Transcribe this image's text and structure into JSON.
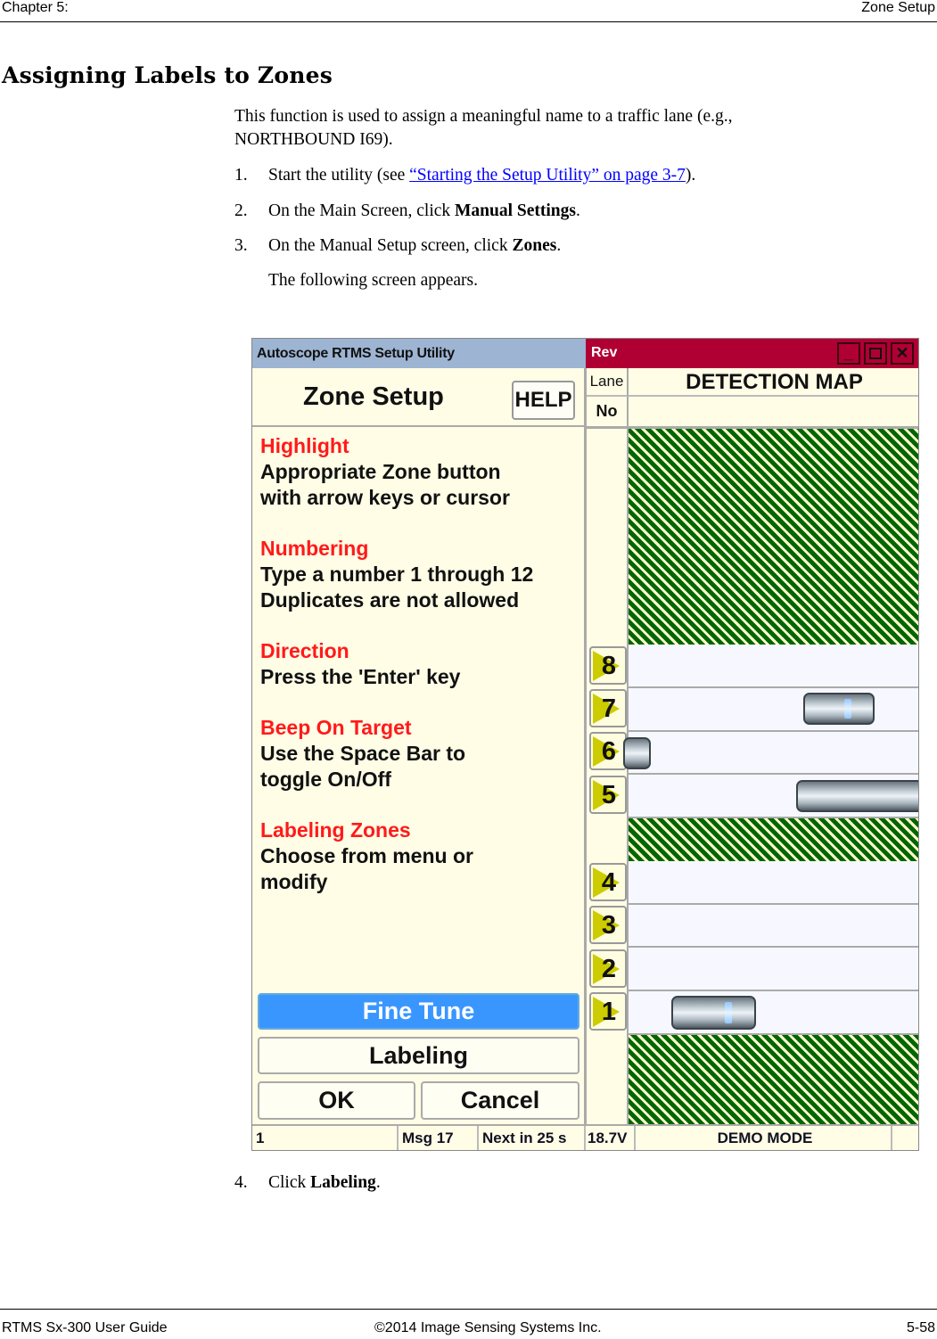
{
  "running_header": {
    "left": "Chapter 5:",
    "right": "Zone Setup"
  },
  "heading": "Assigning Labels to Zones",
  "intro": [
    "This function is used to assign a meaningful name to a traffic lane (e.g.,",
    "NORTHBOUND I69)."
  ],
  "steps": [
    {
      "num": "1.",
      "pre": "Start the utility (see ",
      "link": "“Starting the Setup Utility” on page 3-7",
      "post": ")."
    },
    {
      "num": "2.",
      "pre": "On the Main Screen, click ",
      "bold": "Manual Settings",
      "post": "."
    },
    {
      "num": "3.",
      "pre": "On the Manual Setup screen, click ",
      "bold": "Zones",
      "post": "."
    },
    {
      "num": "4.",
      "pre": "Click ",
      "bold": "Labeling",
      "post": "."
    }
  ],
  "step3_followup": "The following screen appears.",
  "app": {
    "title": "Autoscope RTMS Setup Utility",
    "rev_label": "Rev",
    "window_controls": {
      "minimize": "_",
      "close": "✕"
    },
    "screen_title": "Zone Setup",
    "help_button": "HELP",
    "instructions": [
      {
        "heading": "Highlight",
        "lines": [
          "Appropriate Zone button",
          "with arrow keys or cursor"
        ]
      },
      {
        "heading": "Numbering",
        "lines": [
          "Type a number 1 through 12",
          "Duplicates are not allowed"
        ]
      },
      {
        "heading": "Direction",
        "lines": [
          "Press the 'Enter' key"
        ]
      },
      {
        "heading": "Beep On Target",
        "lines": [
          "Use the Space Bar to",
          "toggle On/Off"
        ]
      },
      {
        "heading": "Labeling Zones",
        "lines": [
          "Choose from menu or",
          "modify"
        ]
      }
    ],
    "buttons": {
      "fine_tune": "Fine Tune",
      "labeling": "Labeling",
      "ok": "OK",
      "cancel": "Cancel"
    },
    "map_header": {
      "lane": "Lane",
      "no": "No",
      "title": "DETECTION MAP"
    },
    "zones": [
      "8",
      "7",
      "6",
      "5",
      "4",
      "3",
      "2",
      "1"
    ],
    "status_bar": {
      "field1": "1",
      "message": "Msg 17",
      "next": "Next in 25 s",
      "voltage": "18.7V",
      "mode": "DEMO MODE",
      "field6": ""
    },
    "colors": {
      "title_bar_left": "#9db4d2",
      "title_bar_right": "#b00033",
      "panel_bg": "#fffde6",
      "heading_red": "#ff1a1a",
      "fine_tune_blue": "#3a96ff",
      "hatch_green": "#006600",
      "zone_arrow": "#cccc00"
    }
  },
  "running_footer": {
    "left": "RTMS Sx-300 User Guide",
    "center": "©2014 Image Sensing Systems Inc.",
    "right": "5-58"
  }
}
